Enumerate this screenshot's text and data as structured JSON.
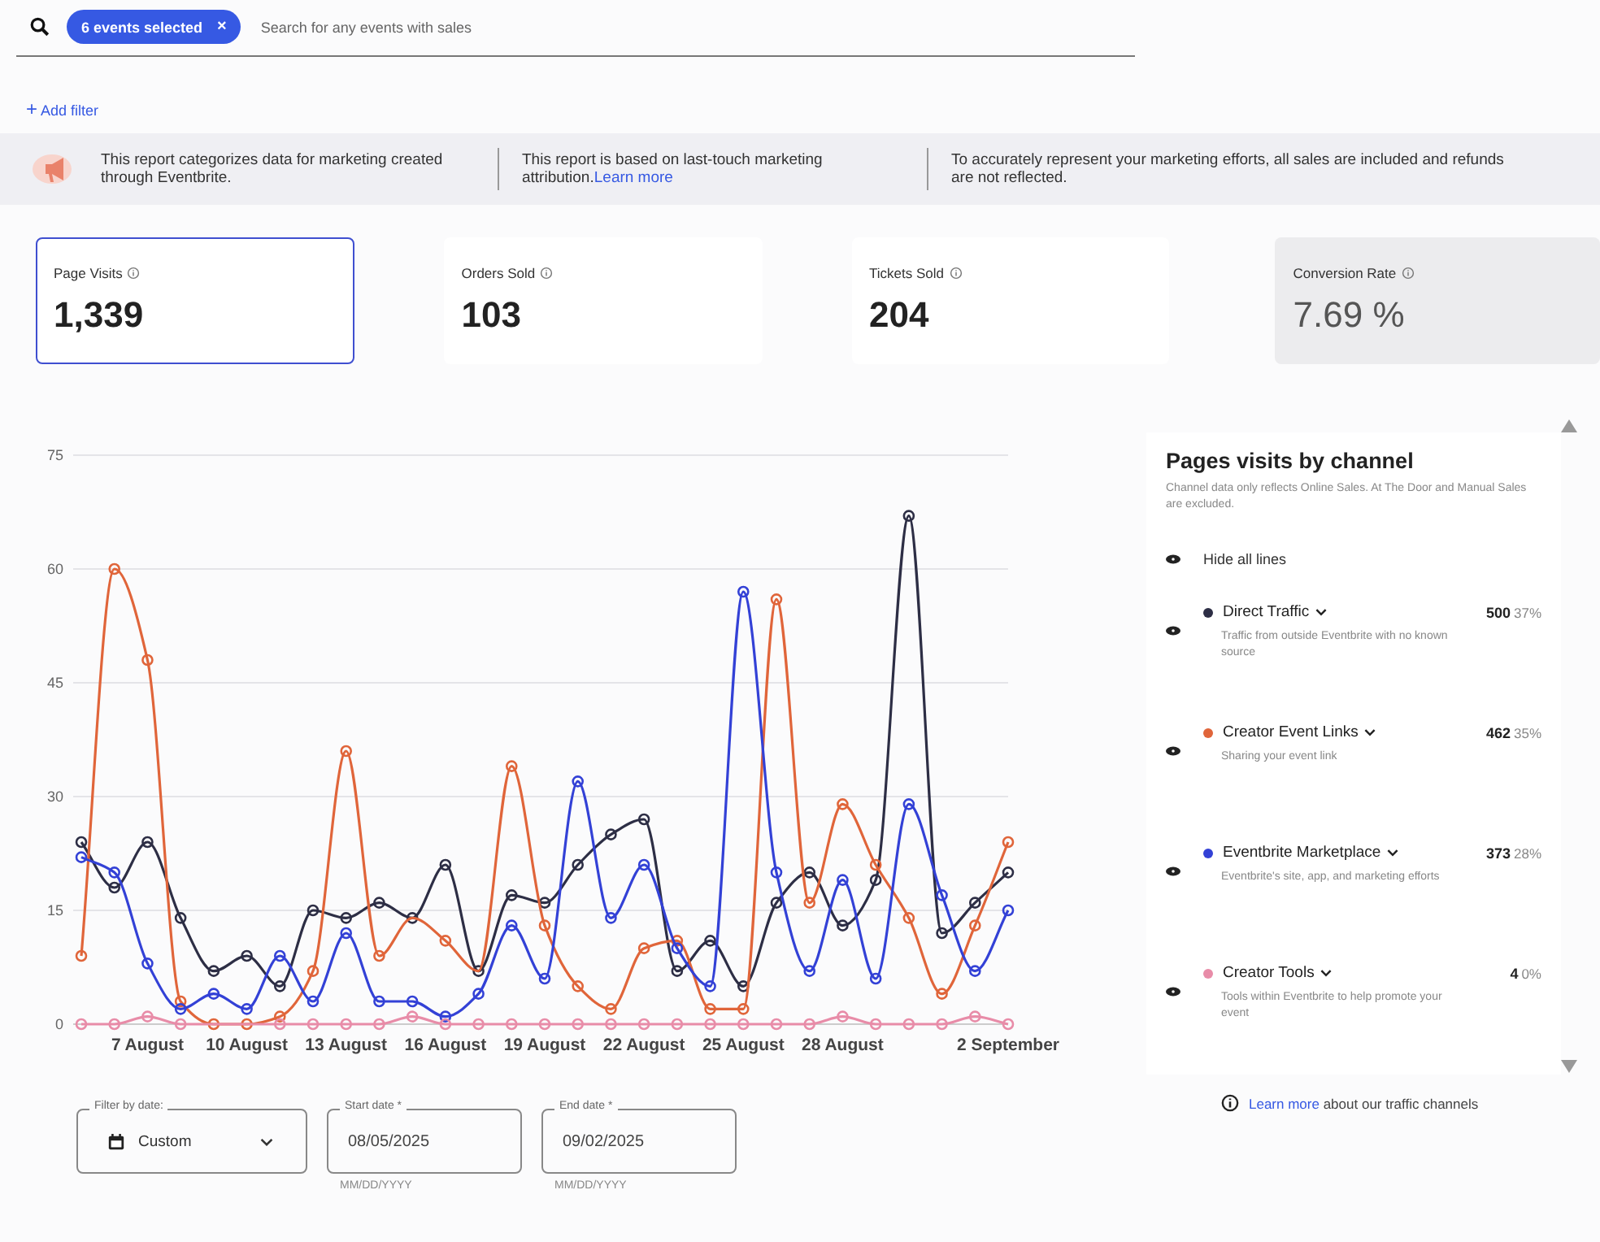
{
  "search": {
    "chip": "6 events selected",
    "chip_close": "×",
    "placeholder": "Search for any events with sales"
  },
  "add_filter": {
    "icon": "+",
    "label": "Add filter"
  },
  "banner": [
    {
      "text": "This report categorizes data for marketing created through Eventbrite."
    },
    {
      "text": "This report is based on last-touch marketing attribution.",
      "link": "Learn more"
    },
    {
      "text": "To accurately represent your marketing efforts, all sales are included and refunds are not reflected."
    }
  ],
  "stats": [
    {
      "label": "Page Visits",
      "value": "1,339",
      "selected": true,
      "kind": "count"
    },
    {
      "label": "Orders Sold",
      "value": "103",
      "selected": false,
      "kind": "count"
    },
    {
      "label": "Tickets Sold",
      "value": "204",
      "selected": false,
      "kind": "count"
    },
    {
      "label": "Conversion Rate",
      "value": "7.69 %",
      "selected": false,
      "kind": "rate"
    }
  ],
  "chart_data": {
    "type": "line",
    "categories": [
      null,
      null,
      "7 August",
      null,
      null,
      "10 August",
      null,
      null,
      "13 August",
      null,
      null,
      "16 August",
      null,
      null,
      "19 August",
      null,
      null,
      "22 August",
      null,
      null,
      "25 August",
      null,
      null,
      "28 August",
      null,
      null,
      null,
      null,
      "2 September"
    ],
    "ylim": [
      0,
      75
    ],
    "yticks": [
      0,
      15,
      30,
      45,
      60,
      75
    ],
    "grid": true,
    "series": [
      {
        "name": "Direct Traffic",
        "color": "#2d2e45",
        "marker": "circle",
        "values": [
          24,
          18,
          24,
          14,
          7,
          9,
          5,
          15,
          14,
          16,
          14,
          21,
          7,
          17,
          16,
          21,
          25,
          27,
          7,
          11,
          5,
          16,
          20,
          13,
          19,
          67,
          12,
          16,
          20
        ]
      },
      {
        "name": "Creator Event Links",
        "color": "#e0653a",
        "marker": "circle",
        "values": [
          9,
          60,
          48,
          3,
          0,
          0,
          1,
          7,
          36,
          9,
          14,
          11,
          7,
          34,
          13,
          5,
          2,
          10,
          11,
          2,
          2,
          56,
          16,
          29,
          21,
          14,
          4,
          13,
          24
        ]
      },
      {
        "name": "Eventbrite Marketplace",
        "color": "#3341d6",
        "marker": "circle",
        "values": [
          22,
          20,
          8,
          2,
          4,
          2,
          9,
          3,
          12,
          3,
          3,
          1,
          4,
          13,
          6,
          32,
          14,
          21,
          10,
          5,
          57,
          20,
          7,
          19,
          6,
          29,
          17,
          7,
          15
        ]
      },
      {
        "name": "Creator Tools",
        "color": "#e88ca8",
        "marker": "circle",
        "values": [
          0,
          0,
          1,
          0,
          0,
          0,
          0,
          0,
          0,
          0,
          1,
          0,
          0,
          0,
          0,
          0,
          0,
          0,
          0,
          0,
          0,
          0,
          0,
          1,
          0,
          0,
          0,
          1,
          0
        ]
      }
    ]
  },
  "legend": {
    "title": "Pages visits by channel",
    "note": "Channel data only reflects Online Sales. At The Door and Manual Sales are excluded.",
    "hide_all": "Hide all lines",
    "channels": [
      {
        "count": "500",
        "percent": "37%",
        "description": "Traffic from outside Eventbrite with no known source"
      },
      {
        "count": "462",
        "percent": "35%",
        "description": "Sharing your event link"
      },
      {
        "count": "373",
        "percent": "28%",
        "description": "Eventbrite's site, app, and marketing efforts"
      },
      {
        "count": "4",
        "percent": "0%",
        "description": "Tools within Eventbrite to help promote your event"
      }
    ],
    "footer_link": "Learn more",
    "footer_text": "about our traffic channels"
  },
  "date_filter": {
    "label": "Filter by date:",
    "value": "Custom"
  },
  "dates": [
    {
      "label": "Start date *",
      "value": "08/05/2025",
      "hint": "MM/DD/YYYY"
    },
    {
      "label": "End date *",
      "value": "09/02/2025",
      "hint": "MM/DD/YYYY"
    }
  ]
}
